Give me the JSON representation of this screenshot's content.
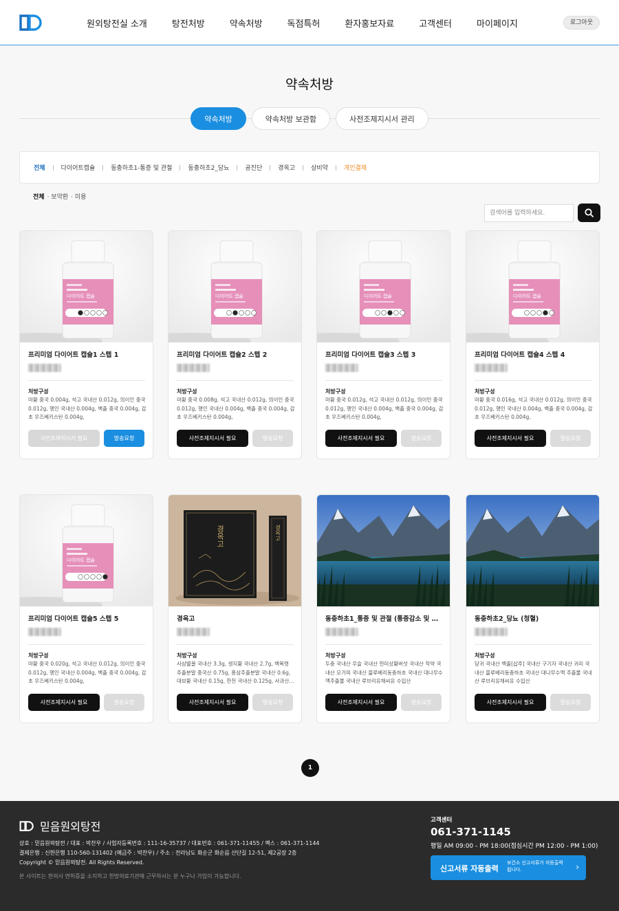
{
  "nav": [
    "원외탕전실 소개",
    "탕전처방",
    "약속처방",
    "독점특허",
    "환자홍보자료",
    "고객센터",
    "마이페이지"
  ],
  "logout_label": "로그아웃",
  "page_title": "약속처방",
  "tabs": [
    "약속처방",
    "약속처방 보관함",
    "사전조제지시서 관리"
  ],
  "categories": [
    "전체",
    "다이어트캡슐",
    "동충하초1-통증 및 관절",
    "동충하초2_당뇨",
    "공진단",
    "경옥고",
    "상비약",
    "개인결제"
  ],
  "subfilter": [
    "전체",
    "· 보약환",
    "· 미용"
  ],
  "search": {
    "placeholder": "검색어를 입력하세요."
  },
  "colors": {
    "accent": "#1a8ee0",
    "dark": "#111111",
    "orange": "#f08a24",
    "footer_bg": "#2b2b2b"
  },
  "card_common": {
    "composition_label": "처방구성",
    "doc_button": "사전조제지시서 필요",
    "send_button": "발송요청"
  },
  "products": [
    {
      "name": "프리미엄 다이어트 캡슐1  스텝 1",
      "image": "pill-bottle",
      "step": 1,
      "desc": "마황 중국 0.004g, 석고 국내산 0.012g, 의이인 중국 0.012g, 행인 국내산 0.004g, 백출 중국 0.004g, 감초 우즈베키스탄 0.004g,",
      "doc_active": false,
      "send_active": true
    },
    {
      "name": "프리미엄 다이어트 캡슐2  스텝 2",
      "image": "pill-bottle",
      "step": 2,
      "desc": "마황 중국 0.008g, 석고 국내산 0.012g, 의이인 중국 0.012g, 행인 국내산 0.004g, 백출 중국 0.004g, 감초 우즈베키스탄 0.004g,",
      "doc_active": true,
      "send_active": false
    },
    {
      "name": "프리미엄 다이어트 캡슐3  스텝 3",
      "image": "pill-bottle",
      "step": 3,
      "desc": "마황 중국 0.012g, 석고 국내산 0.012g, 의이인 중국 0.012g, 행인 국내산 0.004g, 백출 중국 0.004g, 감초 우즈베키스탄 0.004g,",
      "doc_active": true,
      "send_active": false
    },
    {
      "name": "프리미엄 다이어트 캡슐4  스텝 4",
      "image": "pill-bottle",
      "step": 4,
      "desc": "마황 중국 0.016g, 석고 국내산 0.012g, 의이인 중국 0.012g, 행인 국내산 0.004g, 백출 중국 0.004g, 감초 우즈베키스탄 0.004g,",
      "doc_active": true,
      "send_active": false
    },
    {
      "name": "프리미엄 다이어트 캡슐5  스텝 5",
      "image": "pill-bottle",
      "step": 5,
      "desc": "마황 중국 0.020g, 석고 국내산 0.012g, 의이인 중국 0.012g, 행인 국내산 0.004g, 백출 중국 0.004g, 감초 우즈베키스탄 0.004g,",
      "doc_active": true,
      "send_active": false
    },
    {
      "name": "경옥고",
      "image": "gyeongokgo-box",
      "desc": "사삼별꿀 국내산 3.3g, 생지황 국내산 2.7g, 백복령 추출분말 중국산 0.75g, 홍삼추출분말 국내산 0.6g, 대보황 국내산 0.15g, 한천 국내산 0.125g, 사과산...",
      "doc_active": true,
      "send_active": false
    },
    {
      "name": "동충하초1_통증 및 관절  (통증감소 및 유...",
      "image": "lake-landscape",
      "desc": "두충 국내산 우슬 국내산 현미상황버섯 국내산 작약 국내산 오가피 국내산 블루베리동충하초 국내산 대나무수액추출물 국내산 루브리유채씨유 수입산",
      "doc_active": true,
      "send_active": false
    },
    {
      "name": "동충하초2_당뇨  (청혈)",
      "image": "lake-landscape",
      "desc": "당귀 국내산 백출[삽주] 국내산 구기자 국내산 귀리 국내산 블루베리동충하초 국내산 대나무수액 추출물 국내산 루브리유채씨유 수입산",
      "doc_active": true,
      "send_active": false
    }
  ],
  "box_label": "경옥고",
  "bottle_label": "다이어트 캡슐",
  "pagination": {
    "current": "1"
  },
  "footer": {
    "brand": "믿음원외탕전",
    "line1": "상호 : 믿음원외탕전 / 대표 : 박찬우 / 사업자등록번호 : 111-16-35737 / 대표번호 : 061-371-11455 / 팩스 : 061-371-1144",
    "line2": "결제은행 : 신한은행 110-560-131402 (예금주 : 박찬우) / 주소 : 전라남도 화순군 화순읍 산단길 12-51, 제2공장 2층",
    "line3": "Copyright © 믿음원외탕전. All Rights Reserved.",
    "note": "본 사이트는 한의사 면허증을 소지하고 한방의료기관에 근무하시는 분 누구나 가입이 가능합니다.",
    "cs_title": "고객센터",
    "cs_phone": "061-371-1145",
    "cs_hours": "평일 AM 09:00 - PM 18:00(점심시간 PM 12:00 - PM 1:00)",
    "print_main": "신고서류 자동출력",
    "print_sub": "보건소 신고서류가 자동출력 됩니다."
  }
}
